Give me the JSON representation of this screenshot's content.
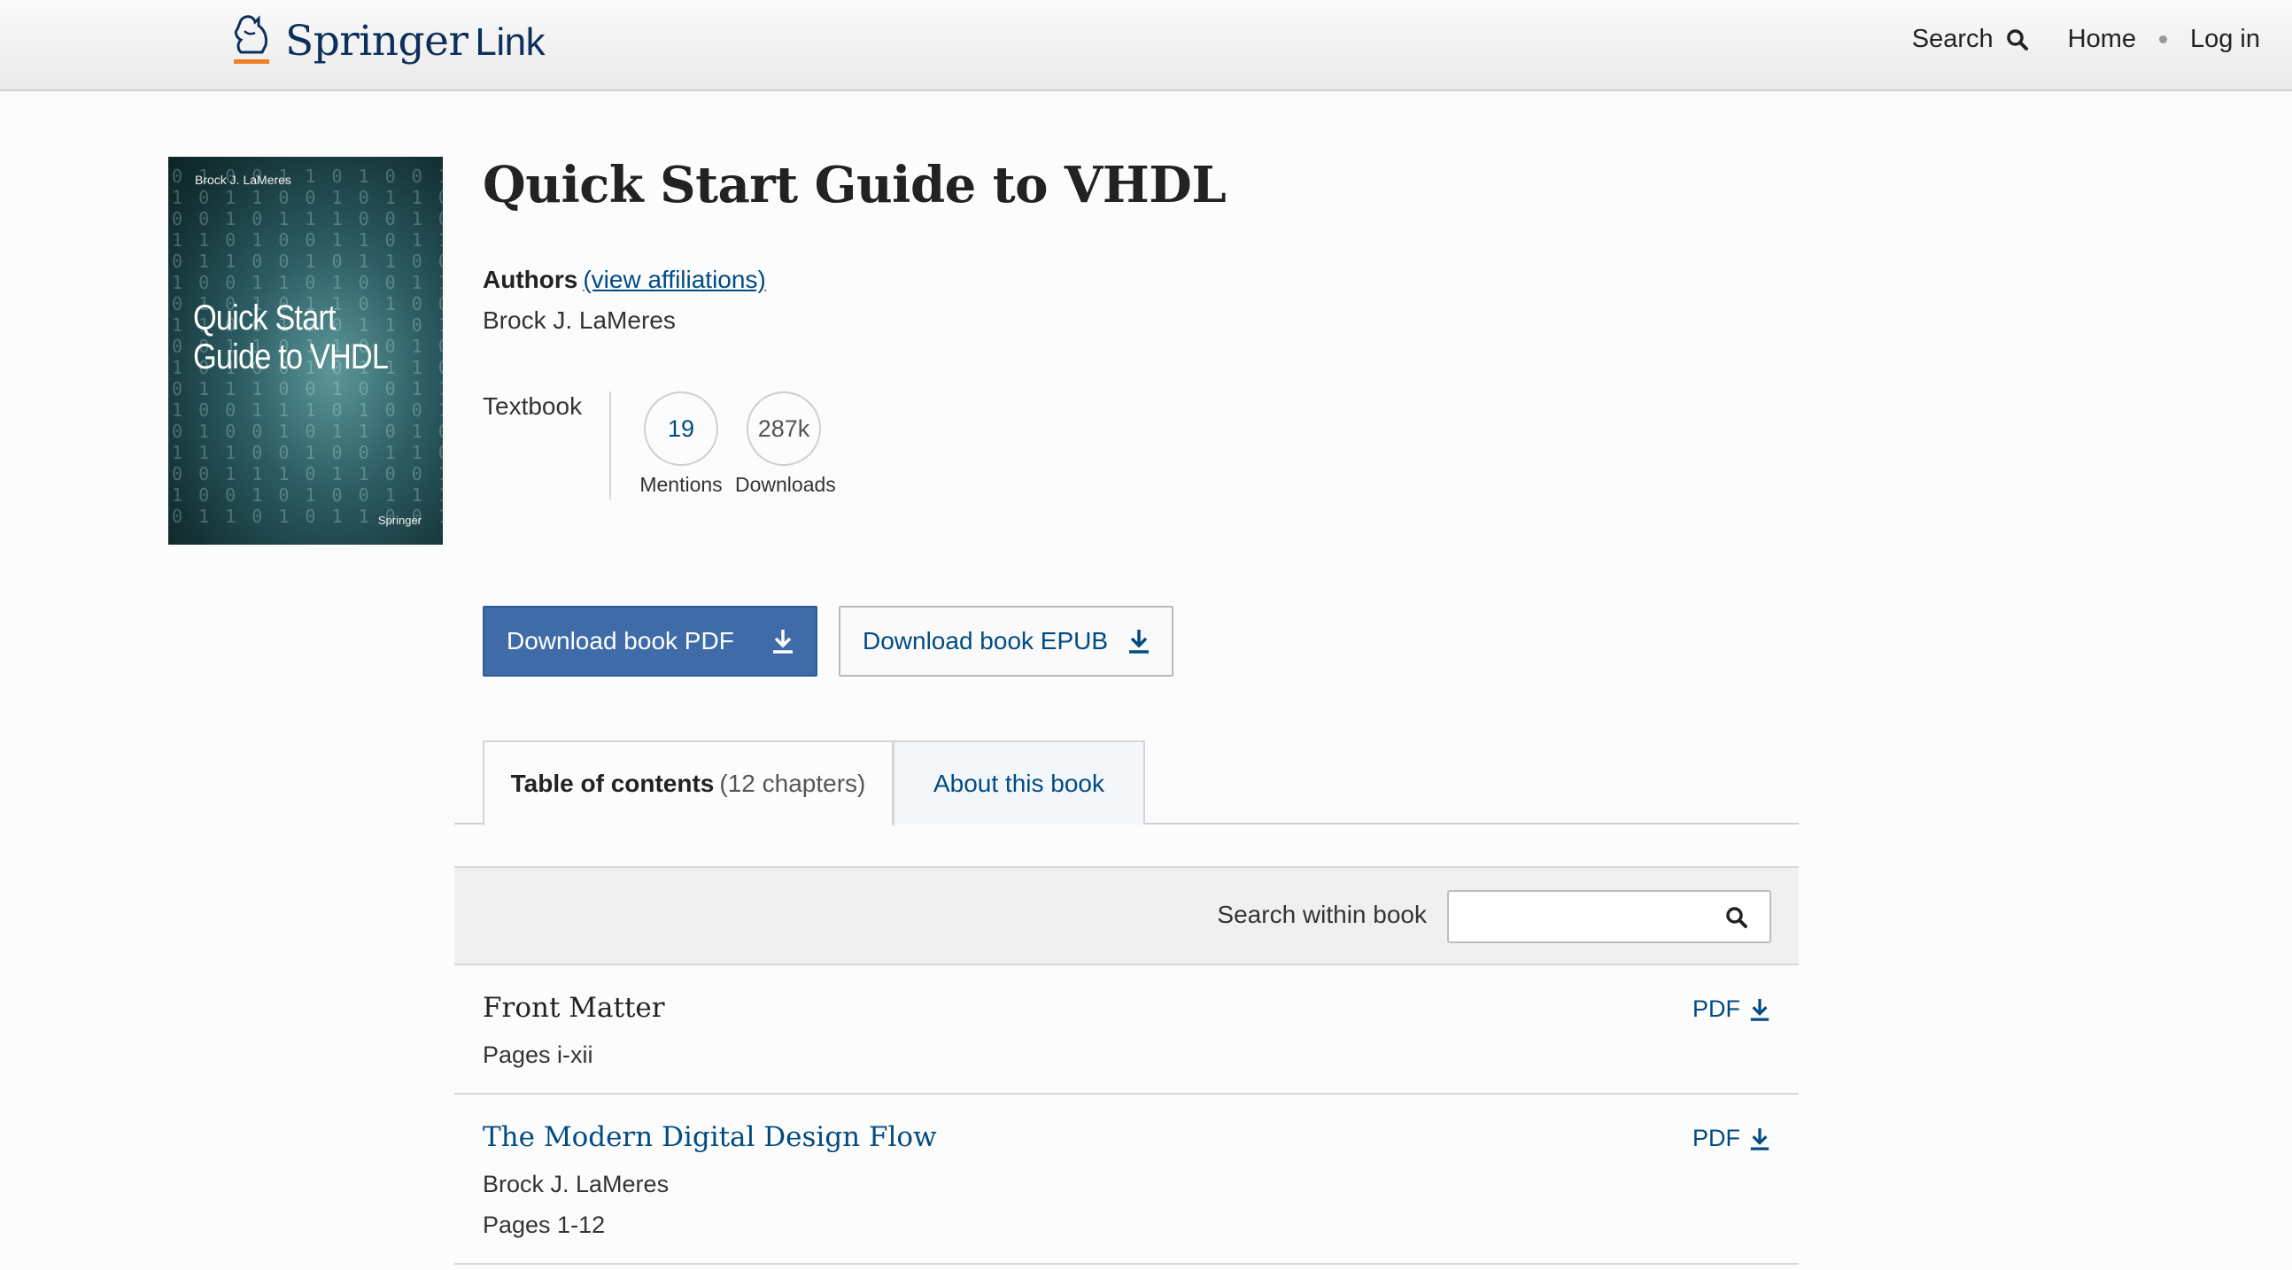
{
  "header": {
    "logo_springer": "Springer",
    "logo_link": "Link",
    "search_label": "Search",
    "home_label": "Home",
    "login_label": "Log in"
  },
  "cover": {
    "author": "Brock J. LaMeres",
    "title_line1": "Quick Start",
    "title_line2": "Guide to VHDL",
    "publisher": "Springer"
  },
  "book": {
    "title": "Quick Start Guide to VHDL",
    "authors_label": "Authors",
    "affiliations_link": "(view affiliations)",
    "author_name": "Brock J. LaMeres",
    "type": "Textbook"
  },
  "metrics": [
    {
      "value": "19",
      "label": "Mentions",
      "color": "#004b83"
    },
    {
      "value": "287k",
      "label": "Downloads",
      "color": "#555555"
    }
  ],
  "buttons": {
    "pdf_label": "Download book PDF",
    "epub_label": "Download book EPUB"
  },
  "tabs": {
    "toc_label": "Table of contents",
    "toc_count": "(12 chapters)",
    "about_label": "About this book"
  },
  "search_within": {
    "label": "Search within book",
    "value": ""
  },
  "chapters": [
    {
      "title": "Front Matter",
      "author": "",
      "pages": "Pages i-xii",
      "pdf": "PDF",
      "is_link": false
    },
    {
      "title": "The Modern Digital Design Flow",
      "author": "Brock J. LaMeres",
      "pages": "Pages 1-12",
      "pdf": "PDF",
      "is_link": true
    }
  ],
  "colors": {
    "link": "#004b83",
    "primary_button": "#3f6ba9",
    "header_bg": "#f2f2f2"
  }
}
